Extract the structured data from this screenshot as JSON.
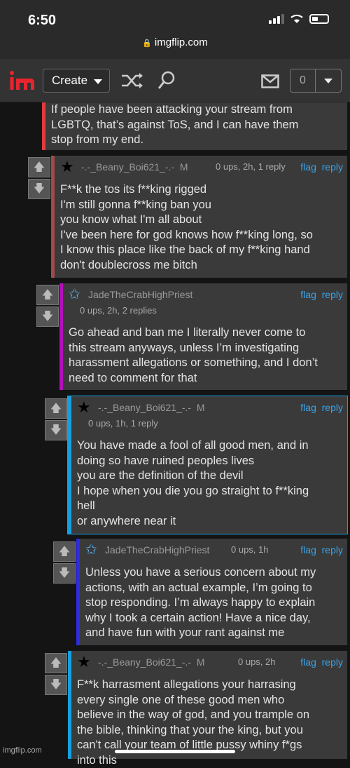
{
  "status": {
    "time": "6:50"
  },
  "url": "imgflip.com",
  "nav": {
    "logo": "im",
    "create_label": "Create",
    "notif_count": "0"
  },
  "comments": [
    {
      "body": "If people have been attacking your stream from\nLGBTQ, that’s against ToS, and I can have them\nstop from my end.",
      "accent": "#e03c3c"
    },
    {
      "user": "-.-_Beany_Boi621_-.-",
      "badge": "M",
      "meta": "0 ups, 2h, 1 reply",
      "flag": "flag",
      "reply": "reply",
      "body": "F**k the tos its f**king rigged\nI'm still gonna f**king ban you\nyou know what I'm all about\nI've been here for god knows how f**king long, so\nI know this place like the back of my f**king hand\ndon't doublecross me bitch",
      "accent": "#a04a4a"
    },
    {
      "user": "JadeTheCrabHighPriest",
      "meta": "0 ups, 2h, 2 replies",
      "flag": "flag",
      "reply": "reply",
      "body": "Go ahead and ban me I literally never come to\nthis stream anyways, unless I’m investigating\nharassment allegations or something, and I don’t\nneed to comment for that",
      "accent": "#b012b8"
    },
    {
      "user": "-.-_Beany_Boi621_-.-",
      "badge": "M",
      "meta": "0 ups, 1h, 1 reply",
      "flag": "flag",
      "reply": "reply",
      "body": "You have made a fool of all good men, and in\ndoing so have ruined peoples lives\nyou are the definition of the devil\nI hope when you die you go straight to f**king\nhell\nor anywhere near it",
      "accent": "#16a0e0"
    },
    {
      "user": "JadeTheCrabHighPriest",
      "meta": "0 ups, 1h",
      "flag": "flag",
      "reply": "reply",
      "body": "Unless you have a serious concern about my\nactions, with an actual example, I’m going to\nstop responding. I’m always happy to explain\nwhy I took a certain action! Have a nice day,\nand have fun with your rant against me",
      "accent": "#2c2ce0"
    },
    {
      "user": "-.-_Beany_Boi621_-.-",
      "badge": "M",
      "meta": "0 ups, 2h",
      "flag": "flag",
      "reply": "reply",
      "body": "F**k harrasment allegations your harrasing\nevery single one of these good men who\nbelieve in the way of god, and you trample on\nthe bible, thinking that your the king, but you\ncan't call your team of little pussy whiny f*gs\ninto this",
      "accent": "#16a0e0"
    }
  ],
  "watermark": "imgflip.com"
}
